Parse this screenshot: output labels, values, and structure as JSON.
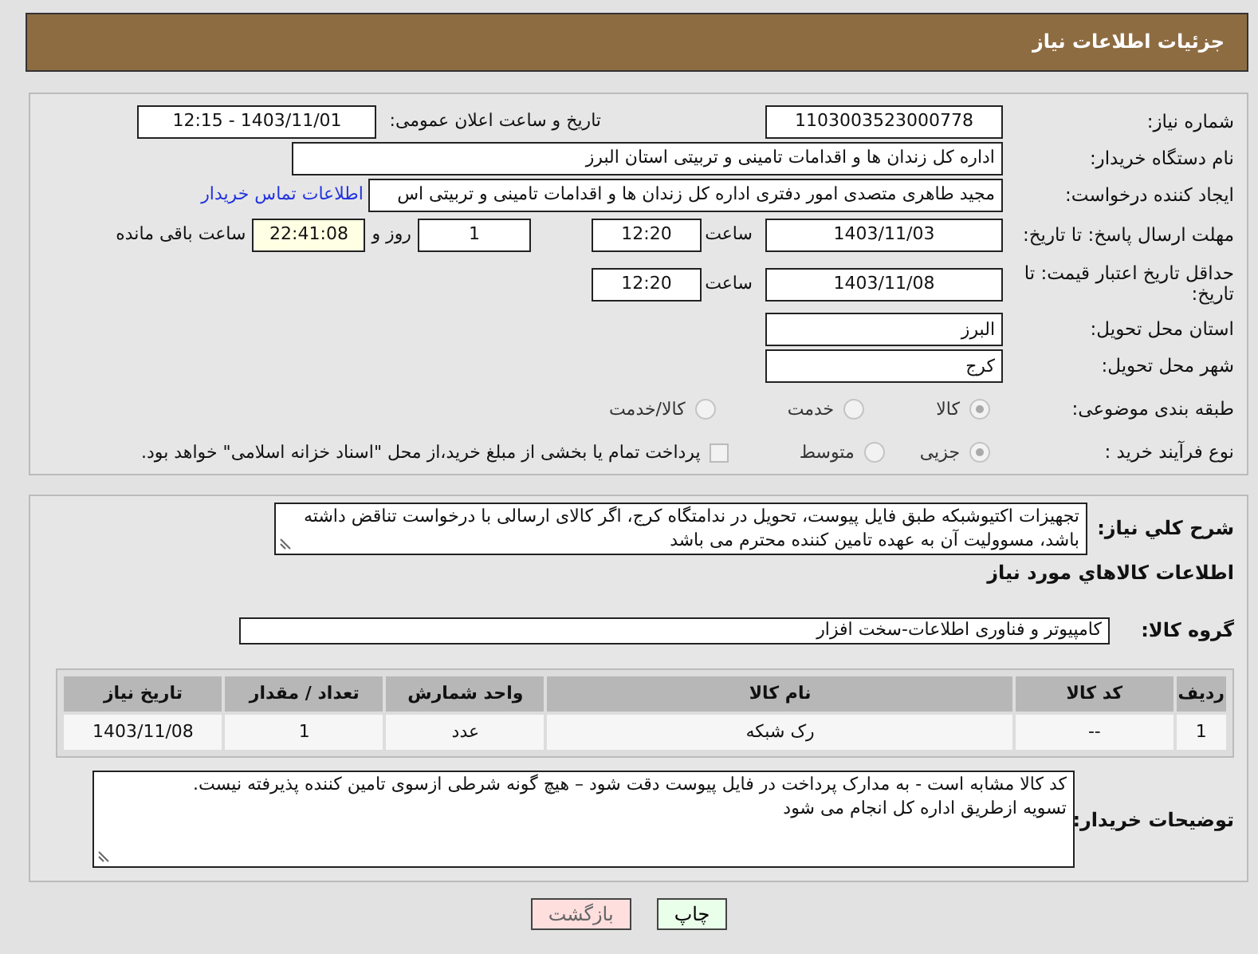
{
  "header": {
    "title": "جزئیات اطلاعات نیاز"
  },
  "need_number": {
    "label": "شماره نیاز:",
    "value": "1103003523000778"
  },
  "announce": {
    "label": "تاریخ و ساعت اعلان عمومی:",
    "value": "1403/11/01 - 12:15"
  },
  "buyer_org": {
    "label": "نام دستگاه خریدار:",
    "value": "اداره کل زندان ها و اقدامات تامینی و تربیتی استان البرز"
  },
  "requester": {
    "label": "ایجاد کننده درخواست:",
    "value": "مجید طاهری متصدی امور دفتری اداره کل زندان ها و اقدامات تامینی و تربیتی اس",
    "link": "اطلاعات تماس خریدار"
  },
  "reply_deadline": {
    "label": "مهلت ارسال پاسخ: تا تاریخ:",
    "date": "1403/11/03",
    "time_label": "ساعت",
    "time": "12:20",
    "days": "1",
    "days_label": "روز و",
    "remaining": "22:41:08",
    "remaining_label": "ساعت باقی مانده"
  },
  "price_validity": {
    "label": "حداقل تاریخ اعتبار قیمت: تا تاریخ:",
    "date": "1403/11/08",
    "time_label": "ساعت",
    "time": "12:20"
  },
  "province": {
    "label": "استان محل تحویل:",
    "value": "البرز"
  },
  "city": {
    "label": "شهر محل تحویل:",
    "value": "کرج"
  },
  "category": {
    "label": "طبقه بندی موضوعی:",
    "options": [
      {
        "label": "کالا",
        "selected": true
      },
      {
        "label": "خدمت",
        "selected": false
      },
      {
        "label": "کالا/خدمت",
        "selected": false
      }
    ]
  },
  "process": {
    "label": "نوع فرآیند خرید :",
    "options": [
      {
        "label": "جزیی",
        "selected": true
      },
      {
        "label": "متوسط",
        "selected": false
      }
    ],
    "treasury": {
      "label": "پرداخت تمام یا بخشی از مبلغ خرید،از محل \"اسناد خزانه اسلامی\" خواهد بود.",
      "checked": false
    }
  },
  "description": {
    "label": "شرح کلي نياز:",
    "text": "تجهیزات اکتیوشبکه طبق فایل پیوست، تحویل در ندامتگاه کرج، اگر کالای ارسالی با درخواست تناقض داشته باشد، مسوولیت آن به عهده تامین کننده محترم می باشد"
  },
  "goods_title": "اطلاعات کالاهاي مورد نياز",
  "goods_group": {
    "label": "گروه کالا:",
    "value": "کامپیوتر و فناوری اطلاعات-سخت افزار"
  },
  "table": {
    "columns": [
      "ردیف",
      "کد کالا",
      "نام کالا",
      "واحد شمارش",
      "تعداد / مقدار",
      "تاریخ نیاز"
    ],
    "rows": [
      [
        "1",
        "--",
        "رک شبکه",
        "عدد",
        "1",
        "1403/11/08"
      ]
    ]
  },
  "buyer_notes": {
    "label": "توضیحات خریدار:",
    "text": "کد کالا مشابه است - به مدارک پرداخت در فایل پیوست دقت شود – هیچ گونه شرطی ازسوی تامین کننده پذیرفته نیست.\nتسویه ازطریق اداره کل انجام می شود"
  },
  "buttons": [
    {
      "label": "چاپ",
      "kind": "print"
    },
    {
      "label": "بازگشت",
      "kind": "back"
    }
  ]
}
